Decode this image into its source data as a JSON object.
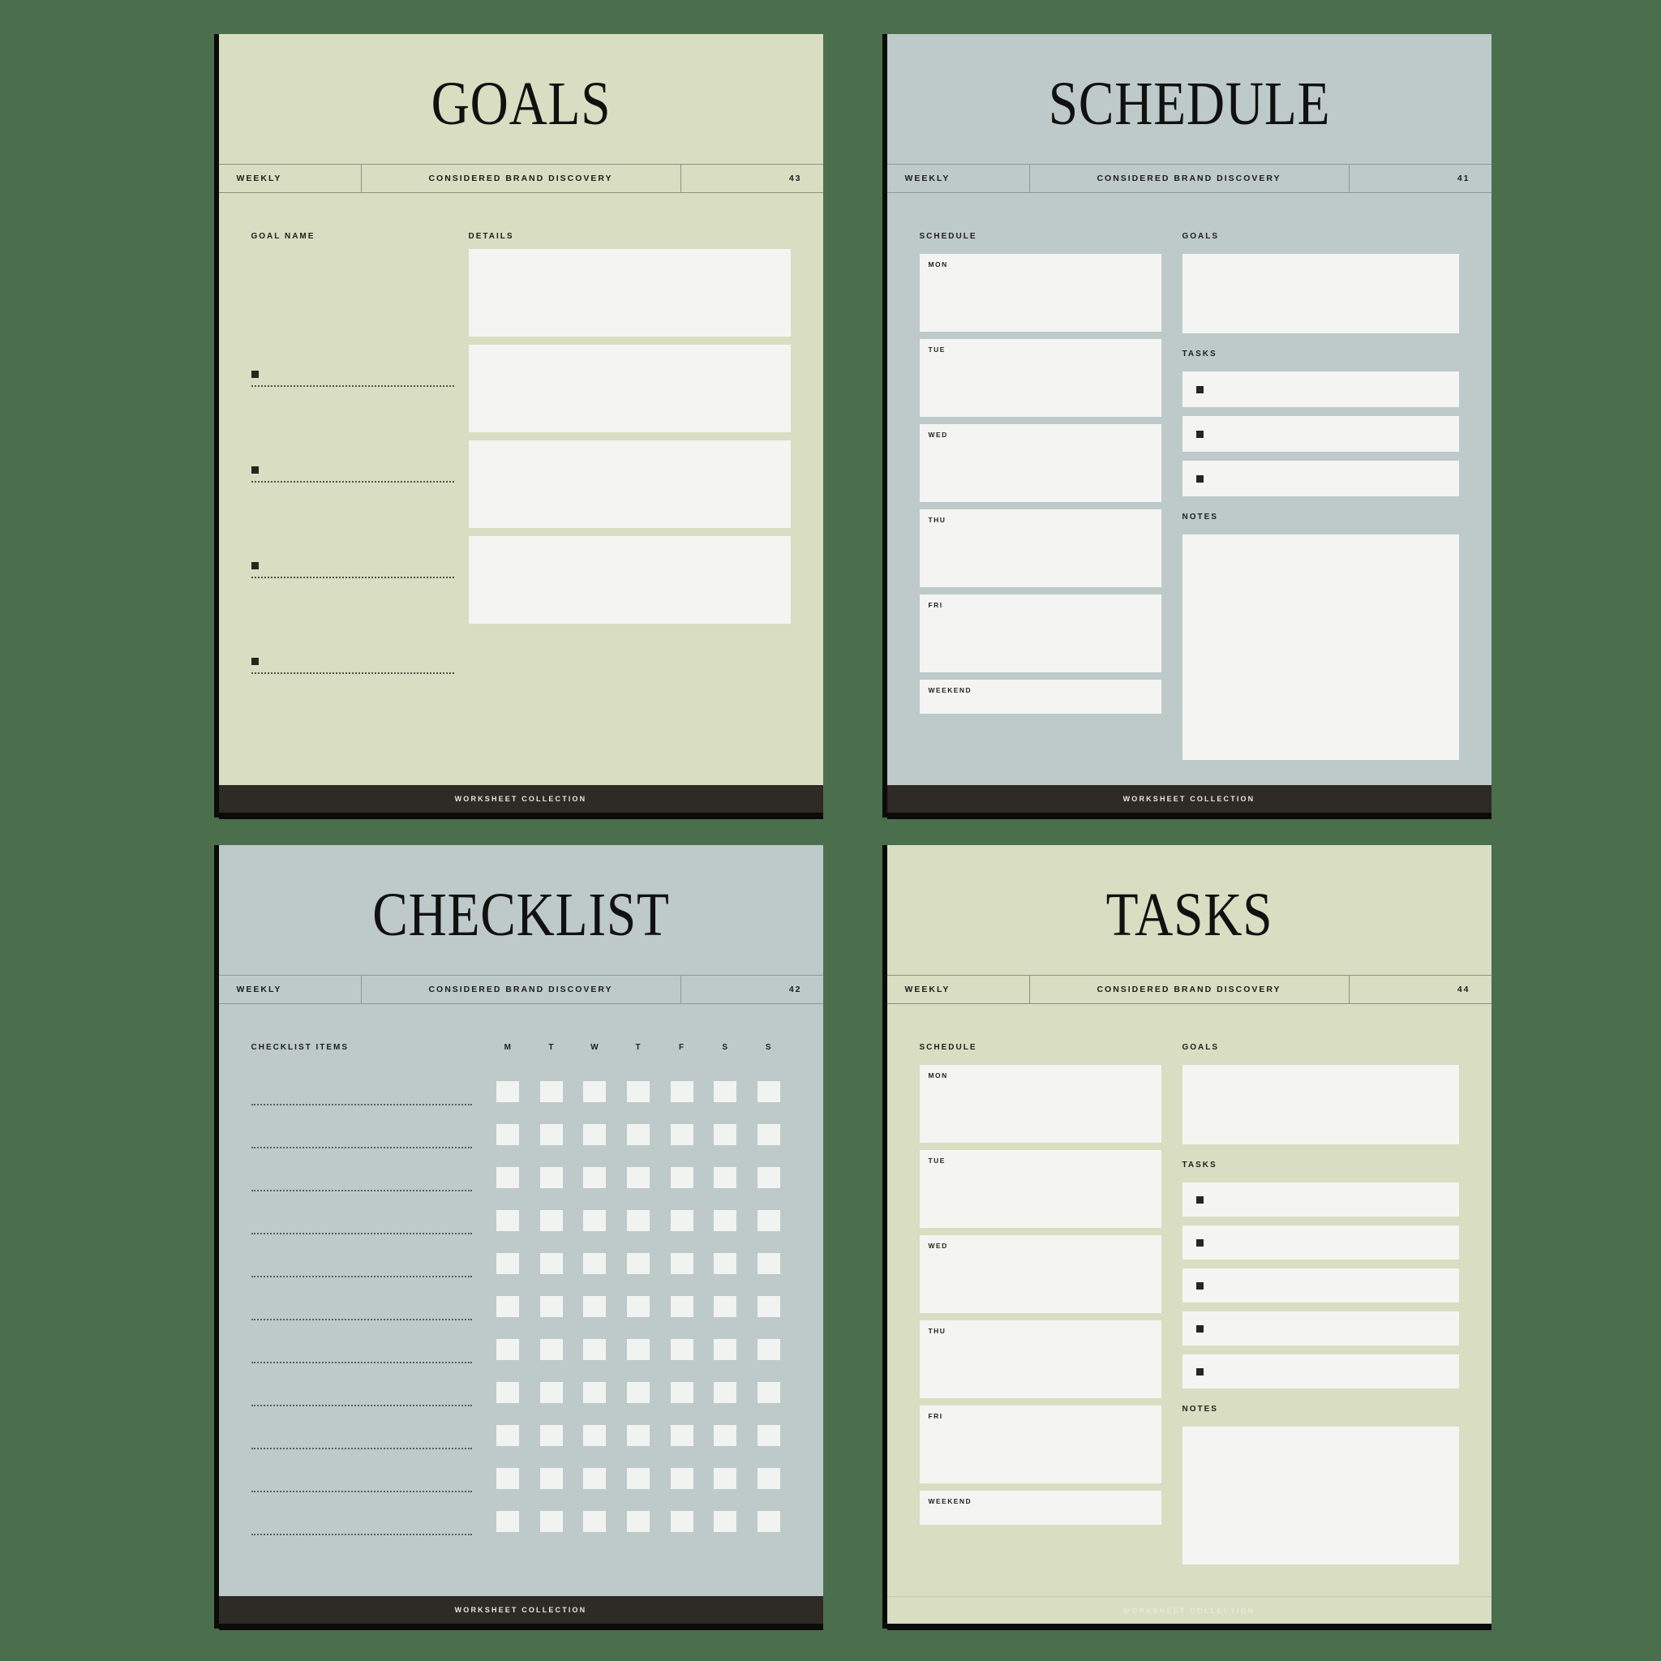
{
  "background_color": "#4b6e4c",
  "footer_label": "WORKSHEET COLLECTION",
  "meta": {
    "frequency": "WEEKLY",
    "brand": "CONSIDERED BRAND DISCOVERY"
  },
  "sheets": {
    "goals": {
      "title": "GOALS",
      "page": "43",
      "theme_color": "#d9ddc2",
      "labels": {
        "left": "GOAL NAME",
        "right": "DETAILS"
      },
      "goal_rows": [
        "",
        "",
        "",
        ""
      ],
      "detail_boxes": [
        "",
        "",
        "",
        ""
      ]
    },
    "schedule": {
      "title": "SCHEDULE",
      "page": "41",
      "theme_color": "#bdcac9",
      "labels": {
        "schedule": "SCHEDULE",
        "goals": "GOALS",
        "tasks": "TASKS",
        "notes": "NOTES"
      },
      "days": [
        "MON",
        "TUE",
        "WED",
        "THU",
        "FRI",
        "WEEKEND"
      ],
      "task_rows": [
        "",
        "",
        ""
      ]
    },
    "checklist": {
      "title": "CHECKLIST",
      "page": "42",
      "theme_color": "#bdcac9",
      "labels": {
        "items": "CHECKLIST ITEMS"
      },
      "day_headers": [
        "M",
        "T",
        "W",
        "T",
        "F",
        "S",
        "S"
      ],
      "row_count": 11
    },
    "tasks": {
      "title": "TASKS",
      "page": "44",
      "theme_color": "#d9ddc2",
      "labels": {
        "schedule": "SCHEDULE",
        "goals": "GOALS",
        "tasks": "TASKS",
        "notes": "NOTES"
      },
      "days": [
        "MON",
        "TUE",
        "WED",
        "THU",
        "FRI",
        "WEEKEND"
      ],
      "task_rows": [
        "",
        "",
        "",
        "",
        ""
      ]
    }
  }
}
